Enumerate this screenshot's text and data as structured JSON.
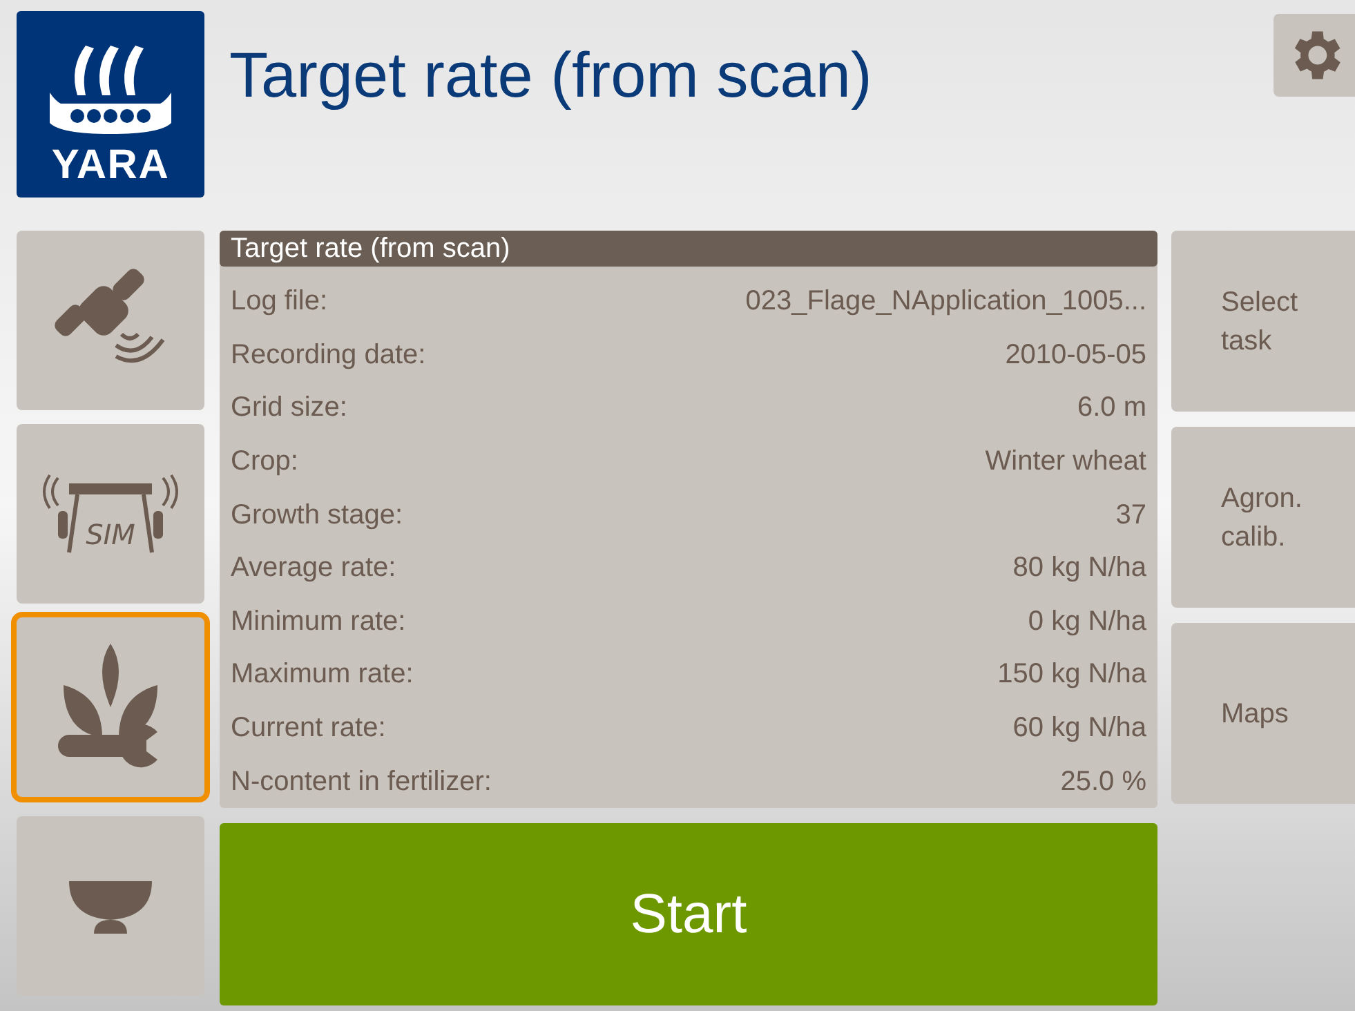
{
  "header": {
    "logo_text": "YARA",
    "title": "Target rate (from scan)"
  },
  "left_nav": [
    {
      "kind": "satellite",
      "selected": false
    },
    {
      "kind": "simulator",
      "selected": false,
      "label": "SIM"
    },
    {
      "kind": "crop",
      "selected": true
    },
    {
      "kind": "spreader",
      "selected": false
    }
  ],
  "panel": {
    "title": "Target rate (from scan)",
    "rows": [
      {
        "label": "Log file:",
        "value": "023_Flage_NApplication_1005..."
      },
      {
        "label": "Recording date:",
        "value": "2010-05-05"
      },
      {
        "label": "Grid size:",
        "value": "6.0 m"
      },
      {
        "label": "Crop:",
        "value": "Winter wheat"
      },
      {
        "label": "Growth stage:",
        "value": "37"
      },
      {
        "label": "Average rate:",
        "value": "80 kg N/ha"
      },
      {
        "label": "Minimum rate:",
        "value": "0 kg N/ha"
      },
      {
        "label": "Maximum rate:",
        "value": "150 kg N/ha"
      },
      {
        "label": "Current rate:",
        "value": "60 kg N/ha"
      },
      {
        "label": "N-content in fertilizer:",
        "value": "25.0 %"
      }
    ]
  },
  "start_button": "Start",
  "right_nav": [
    "Select task",
    "Agron. calib.",
    "Maps"
  ]
}
